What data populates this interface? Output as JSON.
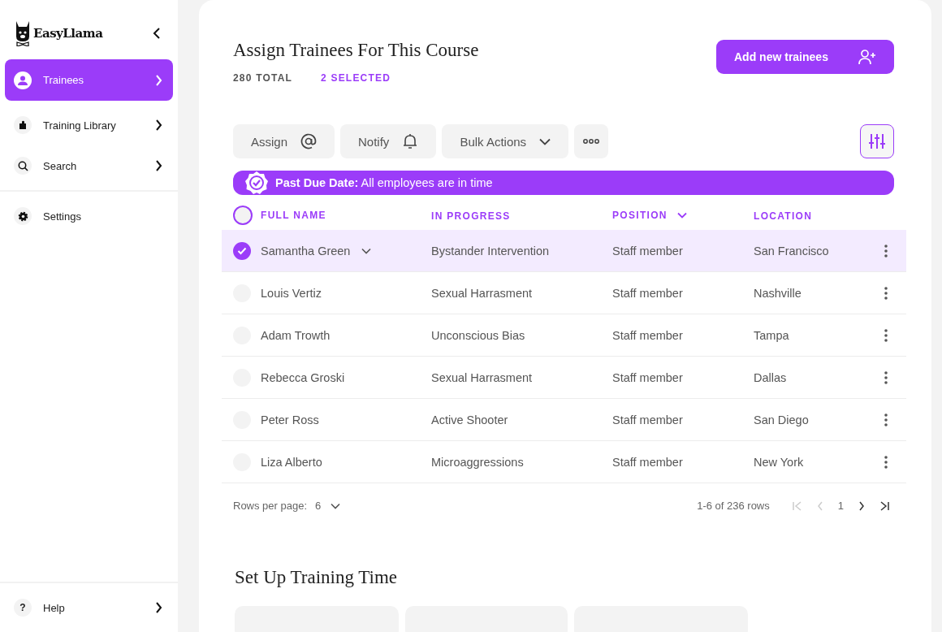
{
  "sidebar": {
    "logo": "EasyLlama",
    "items": [
      {
        "label": "Trainees",
        "selected": true
      },
      {
        "label": "Training Library",
        "selected": false
      },
      {
        "label": "Search",
        "selected": false
      },
      {
        "label": "Settings",
        "selected": false
      }
    ],
    "help": {
      "label": "Help",
      "icon": "?"
    }
  },
  "header": {
    "title": "Assign Trainees For This Course",
    "total": "280 TOTAL",
    "selected_count": "2 SELECTED",
    "add_button": "Add new trainees"
  },
  "toolbar": [
    {
      "label": "Assign"
    },
    {
      "label": "Notify"
    },
    {
      "label": "Bulk Actions"
    }
  ],
  "banner": {
    "text": "**Past Due Date:** All employees are in time"
  },
  "table": {
    "all_selected": false,
    "columns": [
      {
        "label": "FULL NAME",
        "sortable": false
      },
      {
        "label": "IN PROGRESS",
        "sortable": false
      },
      {
        "label": "POSITION",
        "sortable": true
      },
      {
        "label": "LOCATION",
        "sortable": false
      }
    ],
    "rows": [
      {
        "name": "Samantha Green",
        "expandable": true,
        "course": "Bystander Intervention",
        "position": "Staff member",
        "location": "San Francisco",
        "selected": true
      },
      {
        "name": "Louis Vertiz",
        "expandable": false,
        "course": "Sexual Harrasment",
        "position": "Staff member",
        "location": "Nashville",
        "selected": false
      },
      {
        "name": "Adam Trowth",
        "expandable": false,
        "course": "Unconscious Bias",
        "position": "Staff member",
        "location": "Tampa",
        "selected": false
      },
      {
        "name": "Rebecca Groski",
        "expandable": false,
        "course": "Sexual Harrasment",
        "position": "Staff member",
        "location": "Dallas",
        "selected": false
      },
      {
        "name": "Peter Ross",
        "expandable": false,
        "course": "Active Shooter",
        "position": "Staff member",
        "location": "San Diego",
        "selected": false
      },
      {
        "name": "Liza Alberto",
        "expandable": false,
        "course": "Microaggressions",
        "position": "Staff member",
        "location": "New York",
        "selected": false
      }
    ]
  },
  "pagination": {
    "rows_label": "Rows per page:",
    "rows_value": "6",
    "range": "1-6 of 236 rows",
    "page": "1"
  },
  "setup": {
    "title": "Set Up Training Time"
  }
}
